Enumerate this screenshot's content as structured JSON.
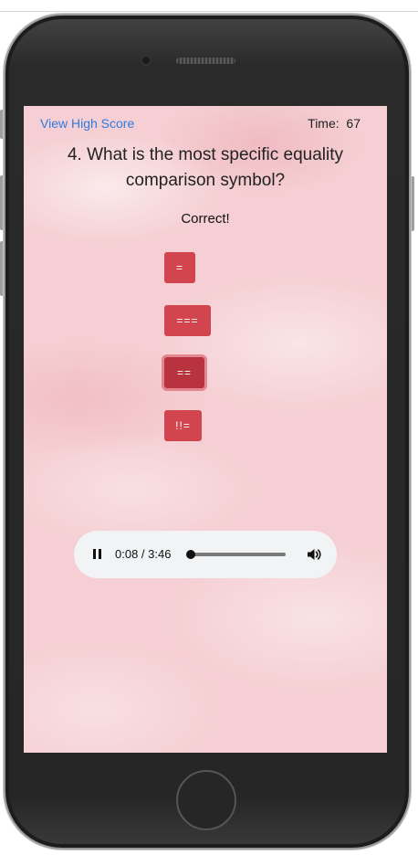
{
  "header": {
    "high_score_link": "View High Score",
    "timer_label": "Time:",
    "timer_value": "67"
  },
  "quiz": {
    "question": "4. What is the most specific equality comparison symbol?",
    "feedback": "Correct!",
    "answers": [
      "=",
      "===",
      "==",
      "!!="
    ],
    "selected_answer_index": 2
  },
  "audio_player": {
    "state": "playing",
    "time_display": "0:08 / 3:46",
    "progress_fraction": 0.035,
    "icons": {
      "play_state": "pause-icon",
      "volume": "volume-icon"
    }
  },
  "colors": {
    "answer_button": "#d2454f",
    "answer_button_selected": "#b8333d",
    "link": "#2f7be0",
    "background": "#f5cfd3"
  }
}
